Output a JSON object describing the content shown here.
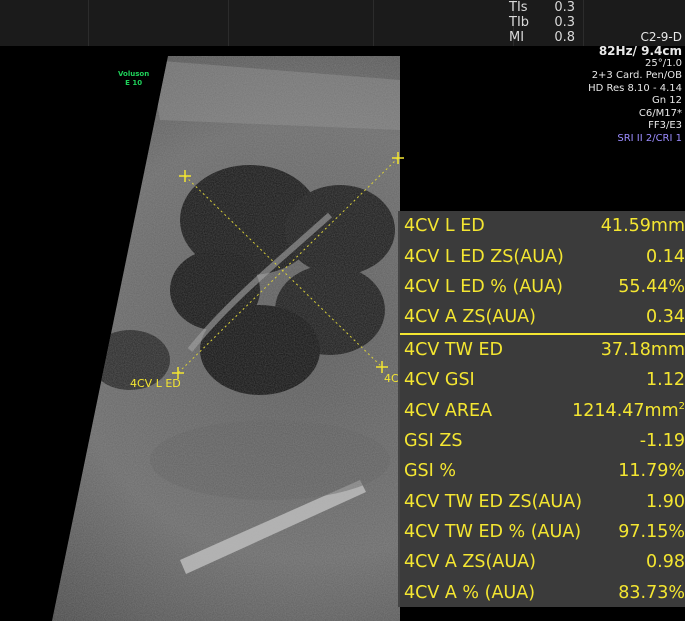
{
  "safety": {
    "tis_label": "TIs",
    "tis_value": "0.3",
    "tib_label": "TIb",
    "tib_value": "0.3",
    "mi_label": "MI",
    "mi_value": "0.8"
  },
  "brand": {
    "line1": "Voluson",
    "line2": "E 10"
  },
  "params": {
    "probe": "C2-9-D",
    "frame_depth": "82Hz/ 9.4cm",
    "angle": "25°/1.0",
    "preset": "2+3 Card. Pen/OB",
    "resolution": "HD Res 8.10 - 4.14",
    "gain": "Gn  12",
    "map": "C6/M17*",
    "ff": "FF3/E3",
    "sri": "SRI II 2/CRI 1"
  },
  "calipers": {
    "label_left": "4CV L ED",
    "label_right": "4C"
  },
  "measurements": [
    {
      "label": "4CV L ED",
      "value": "41.59mm"
    },
    {
      "label": "4CV L ED ZS(AUA)",
      "value": "0.14"
    },
    {
      "label": "4CV L ED % (AUA)",
      "value": "55.44%"
    },
    {
      "label": "4CV A ZS(AUA)",
      "value": "0.34"
    },
    {
      "label": "4CV TW ED",
      "value": "37.18mm"
    },
    {
      "label": "4CV GSI",
      "value": "1.12"
    },
    {
      "label": "4CV AREA",
      "value": "1214.47mm",
      "unit_sup": "2"
    },
    {
      "label": "GSI ZS",
      "value": "-1.19"
    },
    {
      "label": "GSI %",
      "value": "11.79%"
    },
    {
      "label": "4CV TW ED ZS(AUA)",
      "value": "1.90"
    },
    {
      "label": "4CV TW ED % (AUA)",
      "value": "97.15%"
    },
    {
      "label": "4CV A ZS(AUA)",
      "value": "0.98"
    },
    {
      "label": "4CV A % (AUA)",
      "value": "83.73%"
    }
  ],
  "colors": {
    "measure_text": "#f4e631",
    "panel_bg": "#404040",
    "brand": "#1fd15a",
    "sri": "#9b8cff"
  }
}
